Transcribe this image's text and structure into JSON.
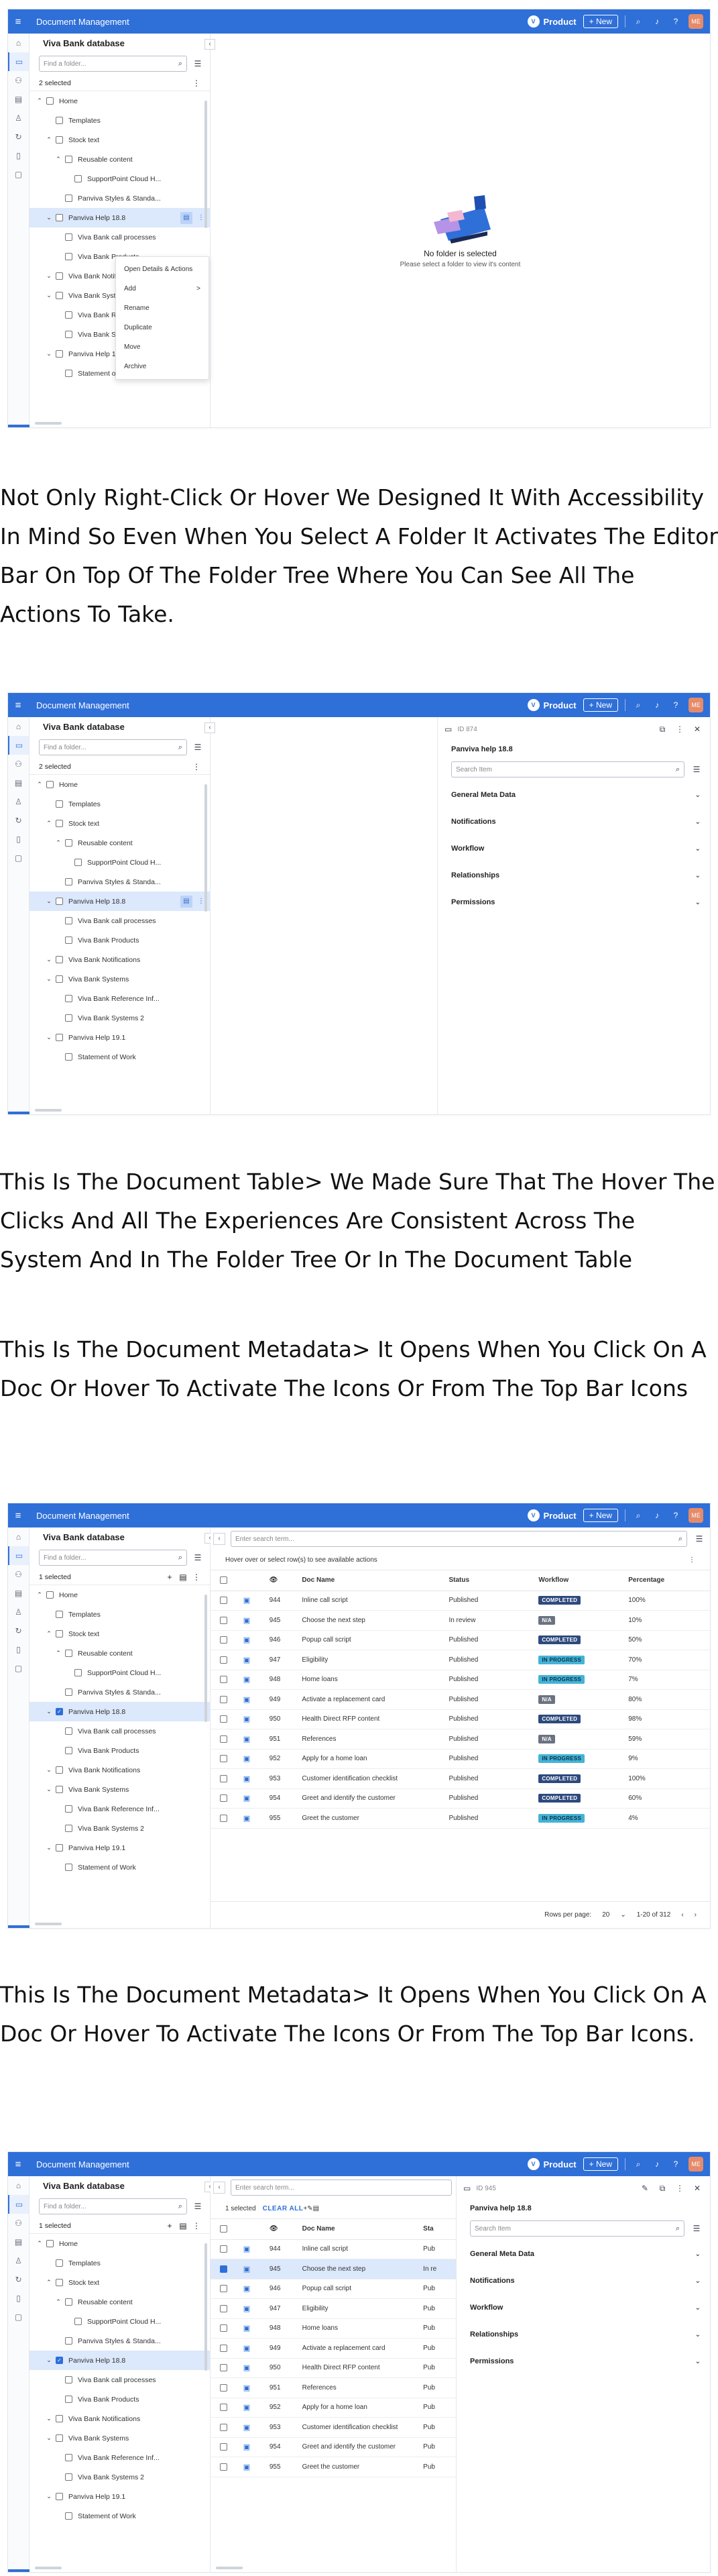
{
  "app": {
    "title": "Document Management",
    "product": "Product",
    "new_label": "+ New",
    "logo_letter": "V",
    "avatar": "ME"
  },
  "tree": {
    "title": "Viva Bank database",
    "search_placeholder": "Find a folder...",
    "selected_2": "2 selected",
    "selected_1": "1 selected",
    "clear_all": "CLEAR ALL"
  },
  "tree_items": [
    {
      "label": "Home",
      "chev": "^",
      "indent": 0
    },
    {
      "label": "Templates",
      "chev": "",
      "indent": 1
    },
    {
      "label": "Stock text",
      "chev": "^",
      "indent": 1
    },
    {
      "label": "Reusable content",
      "chev": "^",
      "indent": 2
    },
    {
      "label": "SupportPoint Cloud H...",
      "chev": "",
      "indent": 3
    },
    {
      "label": "Panviva Styles & Standa...",
      "chev": "",
      "indent": 2
    },
    {
      "label": "Panviva Help 18.8",
      "chev": "v",
      "indent": 1
    },
    {
      "label": "Viva Bank call processes",
      "chev": "",
      "indent": 2
    },
    {
      "label": "Viva Bank Products",
      "chev": "",
      "indent": 2
    },
    {
      "label": "Viva Bank Notifications",
      "chev": "v",
      "indent": 1
    },
    {
      "label": "Viva Bank Systems",
      "chev": "v",
      "indent": 1
    },
    {
      "label": "Viva Bank Reference Inf...",
      "chev": "",
      "indent": 2
    },
    {
      "label": "Viva Bank Systems 2",
      "chev": "",
      "indent": 2
    },
    {
      "label": "Panviva Help 19.1",
      "chev": "v",
      "indent": 1
    },
    {
      "label": "Statement of Work",
      "chev": "",
      "indent": 2
    }
  ],
  "context_menu": [
    {
      "label": "Open Details & Actions",
      "arrow": ""
    },
    {
      "label": "Add",
      "arrow": ">"
    },
    {
      "label": "Rename",
      "arrow": ""
    },
    {
      "label": "Duplicate",
      "arrow": ""
    },
    {
      "label": "Move",
      "arrow": ""
    },
    {
      "label": "Archive",
      "arrow": ""
    }
  ],
  "empty": {
    "title": "No folder is selected",
    "subtitle": "Please select a folder to view it's content"
  },
  "captions": {
    "c1": "Not Only Right-Click Or Hover We Designed It With Accessibility In Mind So Even When You Select A Folder It Activates The Editor Bar On Top Of The Folder Tree Where You Can See All The Actions To Take.",
    "c2": "This Is The Document Table> We Made Sure That The Hover The Clicks And All The Experiences Are Consistent Across The System And In The Folder Tree Or In The Document Table",
    "c3": "This Is The Document Metadata> It Opens When You Click On A Doc Or Hover To Activate The Icons Or From The Top Bar Icons",
    "c4": "This Is The Document Metadata> It Opens When You Click On A Doc Or Hover To Activate The Icons Or From The Top Bar Icons."
  },
  "meta1": {
    "id": "ID 874",
    "title": "Panviva help 18.8",
    "search_placeholder": "Search Item",
    "sections": [
      "General Meta Data",
      "Notifications",
      "Workflow",
      "Relationships",
      "Permissions"
    ]
  },
  "meta2": {
    "id": "ID 945",
    "title": "Panviva help 18.8",
    "search_placeholder": "Search Item",
    "sections": [
      "General Meta Data",
      "Notifications",
      "Workflow",
      "Relationships",
      "Permissions"
    ]
  },
  "doc": {
    "search_placeholder": "Enter search term...",
    "hint": "Hover over or select row(s) to see available actions",
    "headers": [
      "Doc Name",
      "Status",
      "Workflow",
      "Percentage"
    ],
    "header_short": "Sta",
    "rows_per_page_label": "Rows per page:",
    "rows_per_page": "20",
    "range": "1-20 of 312"
  },
  "doc_rows": [
    {
      "id": "944",
      "name": "Inline call script",
      "status": "Published",
      "workflow": "COMPLETED",
      "wf": "completed",
      "pct": "100%"
    },
    {
      "id": "945",
      "name": "Choose the next step",
      "status": "In review",
      "workflow": "N/A",
      "wf": "na",
      "pct": "10%"
    },
    {
      "id": "946",
      "name": "Popup call script",
      "status": "Published",
      "workflow": "COMPLETED",
      "wf": "completed",
      "pct": "50%"
    },
    {
      "id": "947",
      "name": "Eligibility",
      "status": "Published",
      "workflow": "IN PROGRESS",
      "wf": "prog",
      "pct": "70%"
    },
    {
      "id": "948",
      "name": "Home loans",
      "status": "Published",
      "workflow": "IN PROGRESS",
      "wf": "prog",
      "pct": "7%"
    },
    {
      "id": "949",
      "name": "Activate a replacement card",
      "status": "Published",
      "workflow": "N/A",
      "wf": "na",
      "pct": "80%"
    },
    {
      "id": "950",
      "name": "Health Direct RFP content",
      "status": "Published",
      "workflow": "COMPLETED",
      "wf": "completed",
      "pct": "98%"
    },
    {
      "id": "951",
      "name": "References",
      "status": "Published",
      "workflow": "N/A",
      "wf": "na",
      "pct": "59%"
    },
    {
      "id": "952",
      "name": "Apply for a home loan",
      "status": "Published",
      "workflow": "IN PROGRESS",
      "wf": "prog",
      "pct": "9%"
    },
    {
      "id": "953",
      "name": "Customer identification checklist",
      "status": "Published",
      "workflow": "COMPLETED",
      "wf": "completed",
      "pct": "100%"
    },
    {
      "id": "954",
      "name": "Greet and identify the customer",
      "status": "Published",
      "workflow": "COMPLETED",
      "wf": "completed",
      "pct": "60%"
    },
    {
      "id": "955",
      "name": "Greet  the customer",
      "status": "Published",
      "workflow": "IN PROGRESS",
      "wf": "prog",
      "pct": "4%"
    }
  ],
  "status_short": [
    "Pub",
    "In re",
    "Pub",
    "Pub",
    "Pub",
    "Pub",
    "Pub",
    "Pub",
    "Pub",
    "Pub",
    "Pub",
    "Pub"
  ]
}
